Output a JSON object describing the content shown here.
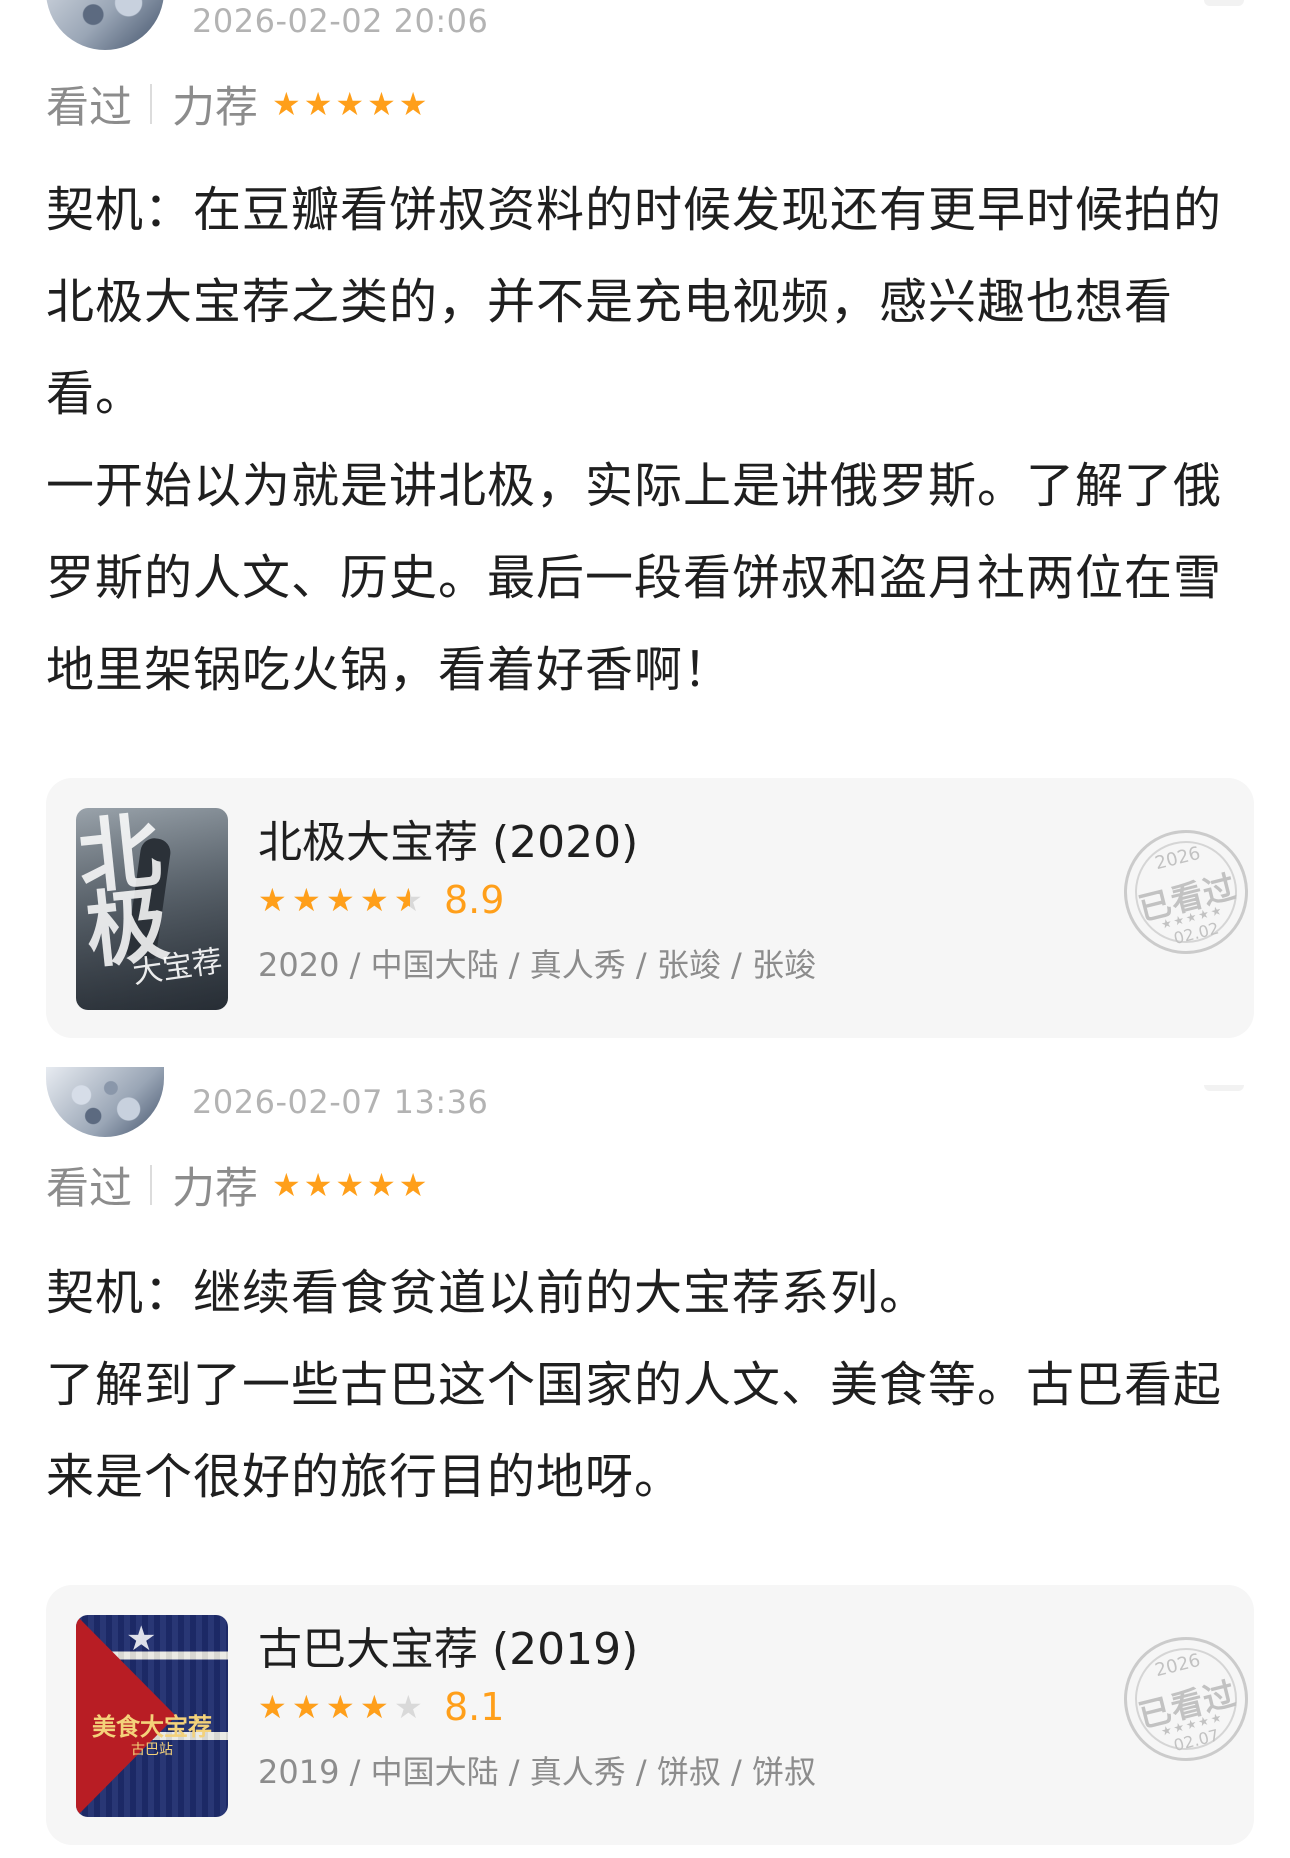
{
  "reviews": [
    {
      "timestamp": "2026-02-02 20:06",
      "status": "看过",
      "rating_label": "力荐",
      "user_stars": 5,
      "paragraphs": [
        "契机：在豆瓣看饼叔资料的时候发现还有更早时候拍的北极大宝荐之类的，并不是充电视频，感兴趣也想看看。",
        "一开始以为就是讲北极，实际上是讲俄罗斯。了解了俄罗斯的人文、历史。最后一段看饼叔和盗月社两位在雪地里架锅吃火锅，看着好香啊！"
      ],
      "card": {
        "title": "北极大宝荐 (2020)",
        "rating": 4.5,
        "score": "8.9",
        "meta": "2020 / 中国大陆 / 真人秀 / 张竣 / 张竣",
        "poster_title": "北极",
        "poster_sub": "大宝荐",
        "seal": {
          "year": "2026",
          "text": "已看过",
          "date": "02.02"
        }
      }
    },
    {
      "timestamp": "2026-02-07 13:36",
      "status": "看过",
      "rating_label": "力荐",
      "user_stars": 5,
      "paragraphs": [
        "契机：继续看食贫道以前的大宝荐系列。",
        "了解到了一些古巴这个国家的人文、美食等。古巴看起来是个很好的旅行目的地呀。"
      ],
      "card": {
        "title": "古巴大宝荐 (2019)",
        "rating": 4,
        "score": "8.1",
        "meta": "2019 / 中国大陆 / 真人秀 / 饼叔 / 饼叔",
        "poster_title": "美食大宝荐",
        "poster_sub": "古巴站",
        "seal": {
          "year": "2026",
          "text": "已看过",
          "date": "02.07"
        }
      }
    }
  ],
  "colors": {
    "accent_orange": "#ff9f1a",
    "muted_gray": "#8c8c8c",
    "card_bg": "#f6f6f6"
  }
}
